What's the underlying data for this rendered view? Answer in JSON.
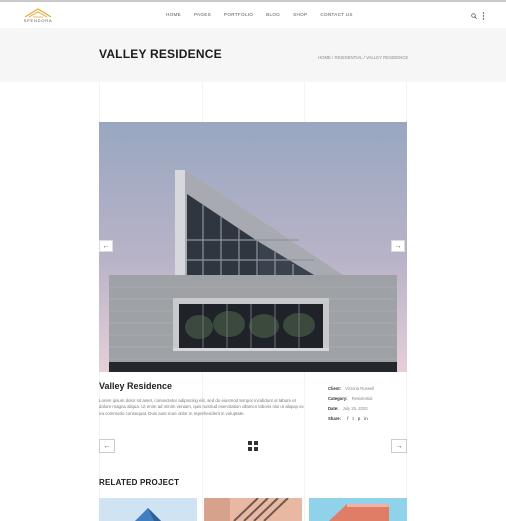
{
  "brand": {
    "name": "SPENDORA"
  },
  "nav": {
    "items": [
      {
        "label": "HOME"
      },
      {
        "label": "PAGES"
      },
      {
        "label": "PORTFOLIO"
      },
      {
        "label": "BLOG"
      },
      {
        "label": "SHOP"
      },
      {
        "label": "CONTACT US"
      }
    ]
  },
  "header_icons": {
    "search": "search-icon",
    "more": "more-vertical-icon"
  },
  "title_bar": {
    "title": "VALLEY RESIDENCE",
    "breadcrumb": "HOME  /  RESIDENTIAL  /  VALLEY RESIDENCE"
  },
  "slider": {
    "prev": "←",
    "next": "→"
  },
  "project": {
    "title": "Valley Residence",
    "description": "Lorem ipsum dolor sit amet, consectetur adipiscing elit, sed do eiusmod tempor incididunt ut labore et dolore magna aliqua. Ut enim ad minim veniam, quis nostrud exercitation ullamco laboris nisi ut aliquip ex ea commodo consequat. Duis aute irure dolor in reprehenderit in voluptate."
  },
  "meta": {
    "client_label": "Client:",
    "client_value": "Victoria Russell",
    "category_label": "Category:",
    "category_value": "Residential",
    "date_label": "Date:",
    "date_value": "July 25, 2020",
    "share_label": "Share:",
    "share_icons": [
      "f",
      "t",
      "p",
      "in"
    ]
  },
  "pager": {
    "prev": "←",
    "next": "→"
  },
  "related": {
    "title": "RELATED PROJECT"
  },
  "colors": {
    "accent": "#e8a93b",
    "sky_top": "#98a7c0",
    "sky_bottom": "#e6cfd8"
  }
}
